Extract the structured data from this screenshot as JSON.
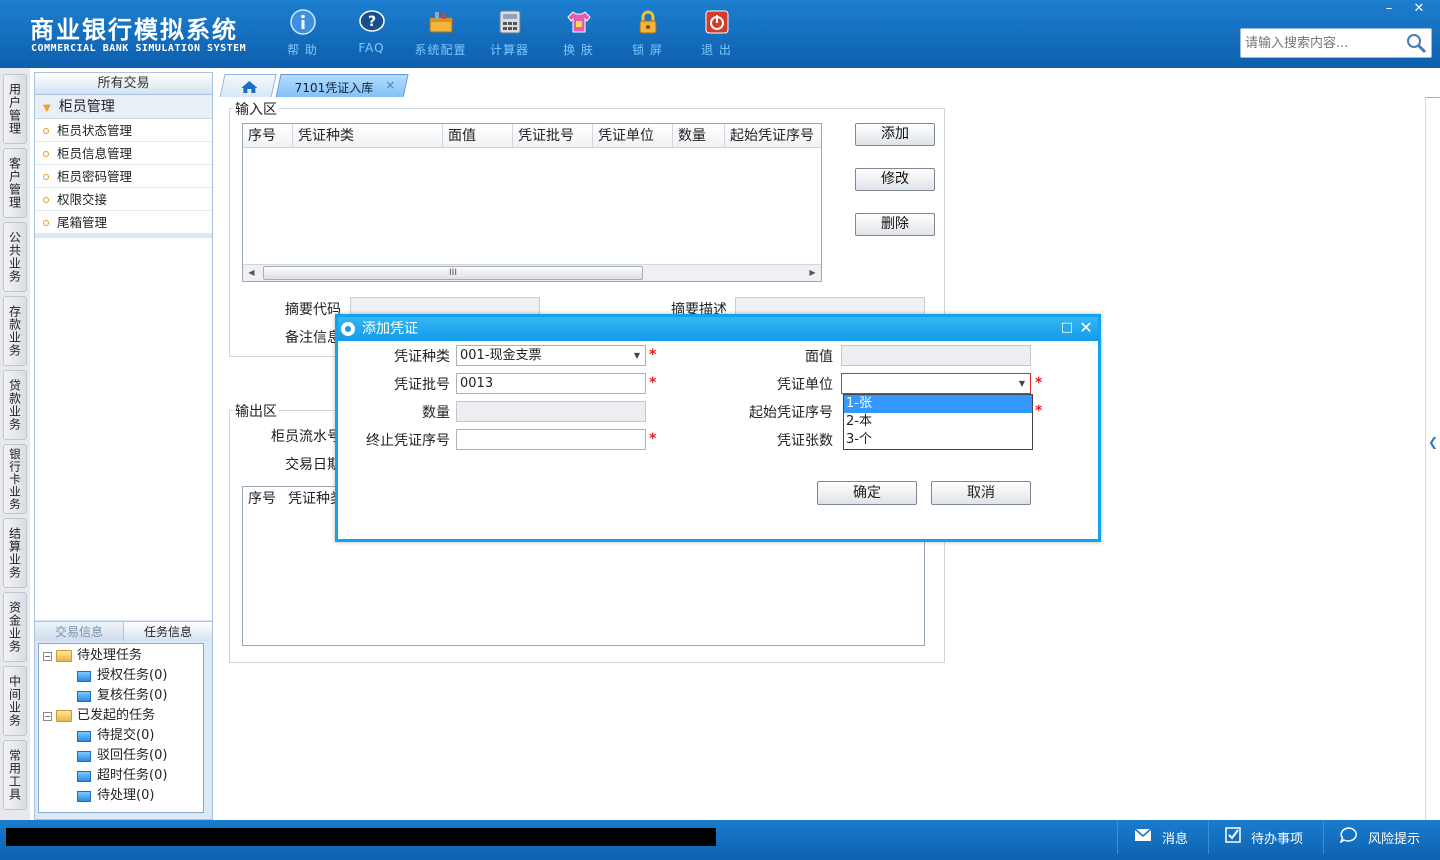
{
  "header": {
    "brand_cn": "商业银行模拟系统",
    "brand_en": "COMMERCIAL BANK SIMULATION SYSTEM",
    "tools": [
      {
        "label": "帮 助",
        "icon": "info-icon"
      },
      {
        "label": "FAQ",
        "icon": "question-icon"
      },
      {
        "label": "系统配置",
        "icon": "toolbox-icon"
      },
      {
        "label": "计算器",
        "icon": "calculator-icon"
      },
      {
        "label": "换 肤",
        "icon": "shirt-icon"
      },
      {
        "label": "锁 屏",
        "icon": "lock-icon"
      },
      {
        "label": "退 出",
        "icon": "power-icon"
      }
    ],
    "search_placeholder": "请输入搜索内容...",
    "win_min": "–",
    "win_close": "✕"
  },
  "vtabs": [
    "用户管理",
    "客户管理",
    "公共业务",
    "存款业务",
    "贷款业务",
    "银行卡业务",
    "结算业务",
    "资金业务",
    "中间业务",
    "常用工具"
  ],
  "leftpanel": {
    "title": "所有交易",
    "category": "柜员管理",
    "items": [
      "柜员状态管理",
      "柜员信息管理",
      "柜员密码管理",
      "权限交接",
      "尾箱管理"
    ],
    "bottom_tabs": [
      "交易信息",
      "任务信息"
    ],
    "tree": {
      "pending": "待处理任务",
      "pending_children": [
        "授权任务(0)",
        "复核任务(0)"
      ],
      "initiated": "已发起的任务",
      "initiated_children": [
        "待提交(0)",
        "驳回任务(0)",
        "超时任务(0)",
        "待处理(0)"
      ]
    }
  },
  "tabs": {
    "active": "7101凭证入库",
    "close": "×"
  },
  "input_area": {
    "legend": "输入区",
    "columns": [
      "序号",
      "凭证种类",
      "面值",
      "凭证批号",
      "凭证单位",
      "数量",
      "起始凭证序号"
    ],
    "buttons": [
      "添加",
      "修改",
      "删除"
    ],
    "scroll_thumb": "III",
    "summary_code_label": "摘要代码",
    "summary_desc_label": "摘要描述",
    "remark_label": "备注信息"
  },
  "output_area": {
    "legend": "输出区",
    "teller_serial_label": "柜员流水号",
    "trade_date_label": "交易日期",
    "columns": [
      "序号",
      "凭证种类"
    ]
  },
  "dialog": {
    "title": "添加凭证",
    "fields": {
      "voucher_type": {
        "label": "凭证种类",
        "value": "001-现金支票"
      },
      "face_value": {
        "label": "面值",
        "value": ""
      },
      "batch_no": {
        "label": "凭证批号",
        "value": "0013"
      },
      "unit": {
        "label": "凭证单位",
        "value": ""
      },
      "quantity": {
        "label": "数量",
        "value": ""
      },
      "start_no": {
        "label": "起始凭证序号",
        "value": ""
      },
      "end_no": {
        "label": "终止凭证序号",
        "value": ""
      },
      "count": {
        "label": "凭证张数",
        "value": ""
      }
    },
    "unit_options": [
      "1-张",
      "2-本",
      "3-个"
    ],
    "required_mark": "*",
    "ok": "确定",
    "cancel": "取消"
  },
  "statusbar": {
    "items": [
      {
        "label": "消息",
        "icon": "mail-icon"
      },
      {
        "label": "待办事项",
        "icon": "checkbox-icon"
      },
      {
        "label": "风险提示",
        "icon": "chat-icon"
      }
    ]
  }
}
